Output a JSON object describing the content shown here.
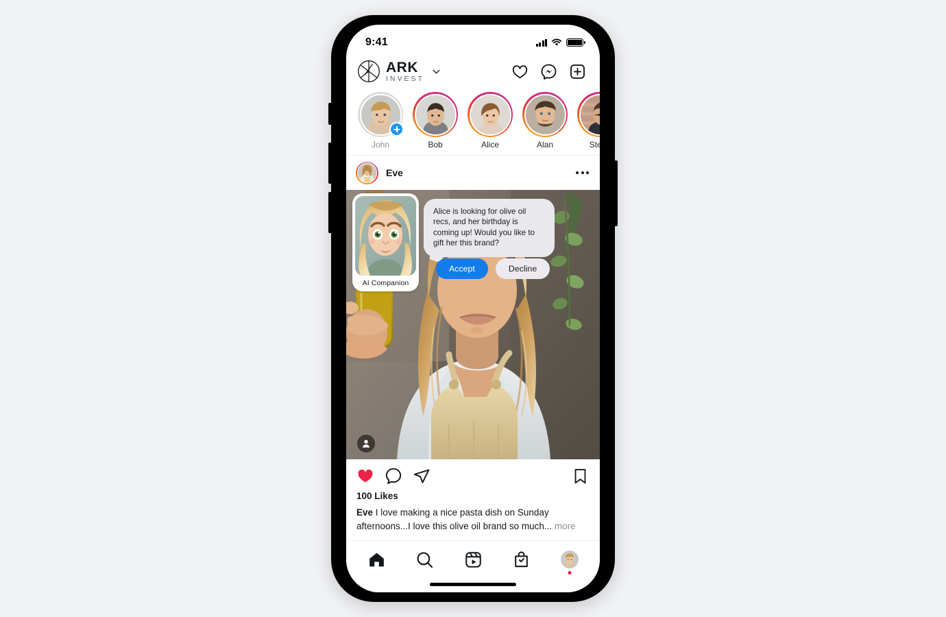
{
  "status_bar": {
    "time": "9:41",
    "signal_icon": "cellular-signal-icon",
    "wifi_icon": "wifi-icon",
    "battery_icon": "battery-full-icon"
  },
  "header": {
    "logo_icon": "ark-invest-logo-icon",
    "brand_name": "ARK",
    "brand_subtitle": "INVEST",
    "chevron_icon": "chevron-down-icon",
    "actions": [
      {
        "name": "notifications-button",
        "icon": "heart-icon"
      },
      {
        "name": "messenger-button",
        "icon": "messenger-icon"
      },
      {
        "name": "create-button",
        "icon": "plus-box-icon"
      }
    ]
  },
  "stories": [
    {
      "name": "John",
      "has_story": false,
      "your_story": true
    },
    {
      "name": "Bob",
      "has_story": true,
      "your_story": false
    },
    {
      "name": "Alice",
      "has_story": true,
      "your_story": false
    },
    {
      "name": "Alan",
      "has_story": true,
      "your_story": false
    },
    {
      "name": "Steve",
      "has_story": true,
      "your_story": false
    }
  ],
  "post": {
    "username": "Eve",
    "more_icon": "more-options-icon",
    "tagged_icon": "tagged-people-icon",
    "likes": "100 Likes",
    "caption_author": "Eve",
    "caption_text": " I love making a nice pasta dish on Sunday afternoons...I love this olive oil brand so much... ",
    "caption_more": "more",
    "actions": [
      {
        "name": "like-button",
        "icon": "heart-filled-icon",
        "state": "liked"
      },
      {
        "name": "comment-button",
        "icon": "comment-icon",
        "state": "default"
      },
      {
        "name": "share-button",
        "icon": "share-paperplane-icon",
        "state": "default"
      },
      {
        "name": "save-button",
        "icon": "bookmark-icon",
        "state": "default"
      }
    ]
  },
  "ai_overlay": {
    "card_label": "AI Companion",
    "avatar_icon": "ai-companion-avatar-icon",
    "message": "Alice is looking for olive oil recs, and her birthday is coming up! Would you like to gift her this brand?",
    "accept_label": "Accept",
    "decline_label": "Decline"
  },
  "tab_bar": {
    "items": [
      {
        "name": "tab-home",
        "icon": "home-icon",
        "active": true
      },
      {
        "name": "tab-search",
        "icon": "search-icon",
        "active": false
      },
      {
        "name": "tab-reels",
        "icon": "reels-icon",
        "active": false
      },
      {
        "name": "tab-shop",
        "icon": "shop-bag-icon",
        "active": false
      },
      {
        "name": "tab-profile",
        "icon": "profile-avatar-icon",
        "active": false
      }
    ]
  },
  "colors": {
    "accent_blue": "#127ceb",
    "like_red": "#ed2348",
    "notification_dot": "#ed1b4b",
    "canvas": "#f1f2f4",
    "story_ring_start": "#f9c23c",
    "story_ring_end": "#c13584"
  }
}
